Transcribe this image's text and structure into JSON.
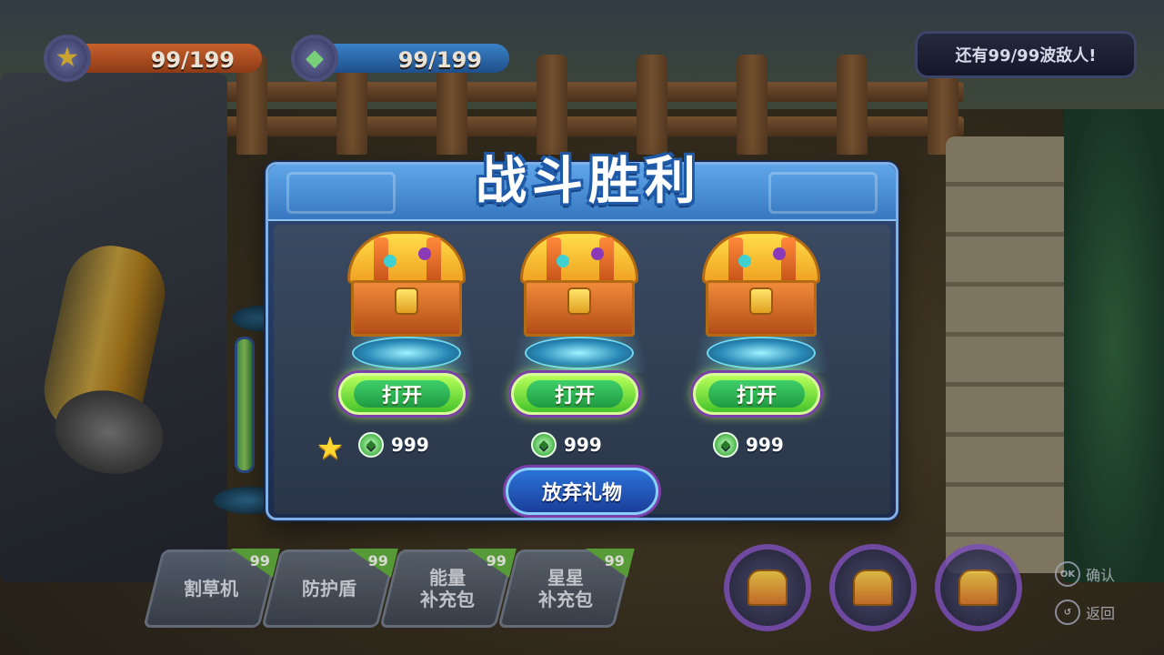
{
  "hud": {
    "star_value": "99/199",
    "gem_value": "99/199",
    "enemy_notice": "还有99/99波敌人!"
  },
  "dialog": {
    "title": "战斗胜利",
    "chests": [
      {
        "open_label": "打开",
        "cost": "999"
      },
      {
        "open_label": "打开",
        "cost": "999"
      },
      {
        "open_label": "打开",
        "cost": "999"
      }
    ],
    "give_up_label": "放弃礼物"
  },
  "tools": [
    {
      "label": "割草机",
      "count": "99"
    },
    {
      "label": "防护盾",
      "count": "99"
    },
    {
      "label": "能量\n补充包",
      "count": "99"
    },
    {
      "label": "星星\n补充包",
      "count": "99"
    }
  ],
  "hints": {
    "confirm_key": "OK",
    "confirm_label": "确认",
    "back_key": "↺",
    "back_label": "返回"
  },
  "icons": {
    "star": "star-icon",
    "gem": "gem-icon",
    "chest": "treasure-chest-icon"
  },
  "colors": {
    "open_button": "#46c42c",
    "give_up_button": "#1a3e9a",
    "dialog_header": "#3778c0",
    "title_outline": "#1f5aa8"
  }
}
